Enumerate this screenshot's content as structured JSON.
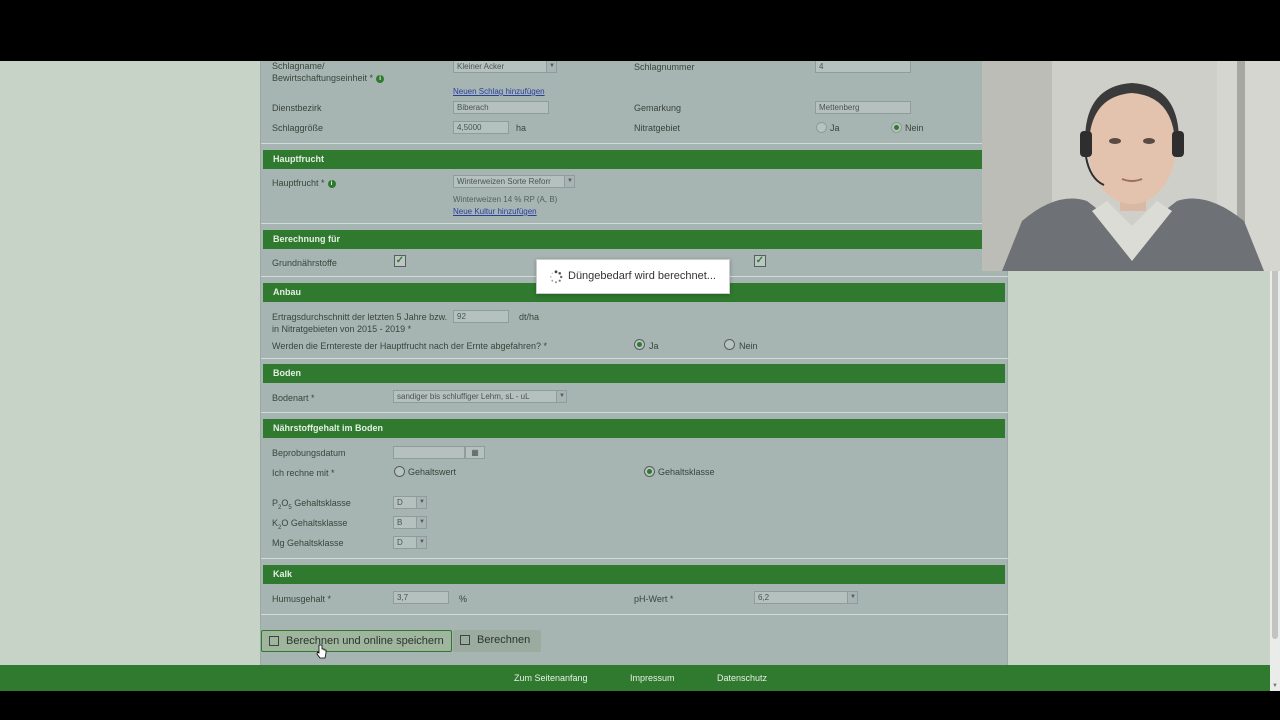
{
  "schlag": {
    "schlagname_label_1": "Schlagname/",
    "schlagname_label_2": "Bewirtschaftungseinheit *",
    "schlagname_value": "Kleiner Acker",
    "neuer_schlag_link": "Neuen Schlag hinzufügen",
    "schlagnummer_label": "Schlagnummer",
    "schlagnummer_value": "4",
    "dienstbezirk_label": "Dienstbezirk",
    "dienstbezirk_value": "Biberach",
    "gemarkung_label": "Gemarkung",
    "gemarkung_value": "Mettenberg",
    "schlaggroesse_label": "Schlaggröße",
    "schlaggroesse_value": "4,5000",
    "schlaggroesse_unit": "ha",
    "nitratgebiet_label": "Nitratgebiet",
    "nitratgebiet_ja": "Ja",
    "nitratgebiet_nein": "Nein"
  },
  "hauptfrucht": {
    "section_title": "Hauptfrucht",
    "label": "Hauptfrucht *",
    "value": "Winterweizen Sorte Reforr",
    "hint": "Winterweizen 14 % RP (A, B)",
    "neue_kultur_link": "Neue Kultur hinzufügen"
  },
  "berechnung": {
    "section_title": "Berechnung für",
    "grundnaehrstoffe_label": "Grundnährstoffe"
  },
  "anbau": {
    "section_title": "Anbau",
    "ertrag_label_1": "Ertragsdurchschnitt der letzten 5 Jahre bzw.",
    "ertrag_label_2": "in Nitratgebieten von 2015 - 2019 *",
    "ertrag_value": "92",
    "ertrag_unit": "dt/ha",
    "erntereste_label": "Werden die Erntereste der Hauptfrucht nach der Ernte abgefahren? *",
    "ja": "Ja",
    "nein": "Nein"
  },
  "boden": {
    "section_title": "Boden",
    "bodenart_label": "Bodenart *",
    "bodenart_value": "sandiger bis schluffiger Lehm, sL - uL"
  },
  "naehrstoff": {
    "section_title": "Nährstoffgehalt im Boden",
    "beprobungsdatum_label": "Beprobungsdatum",
    "rechne_label": "Ich rechne mit *",
    "gehaltswert": "Gehaltswert",
    "gehaltsklasse": "Gehaltsklasse",
    "p2o5_label_a": "P",
    "p2o5_label_b": "2",
    "p2o5_label_c": "O",
    "p2o5_label_d": "5",
    "p2o5_label_e": " Gehaltsklasse",
    "p2o5_value": "D",
    "k2o_label_a": "K",
    "k2o_label_b": "2",
    "k2o_label_c": "O Gehaltsklasse",
    "k2o_value": "B",
    "mg_label": "Mg Gehaltsklasse",
    "mg_value": "D"
  },
  "kalk": {
    "section_title": "Kalk",
    "humus_label": "Humusgehalt *",
    "humus_value": "3,7",
    "humus_unit": "%",
    "ph_label": "pH-Wert *",
    "ph_value": "6,2"
  },
  "actions": {
    "save_button": "Berechnen und online speichern",
    "calc_button": "Berechnen"
  },
  "toast": {
    "text": "Düngebedarf wird berechnet..."
  },
  "footer": {
    "top_link": "Zum Seitenanfang",
    "impressum": "Impressum",
    "datenschutz": "Datenschutz"
  },
  "colors": {
    "section_green": "#2f7a2e",
    "form_bg": "#a6b4b2",
    "page_bg": "#c7d3c7"
  }
}
